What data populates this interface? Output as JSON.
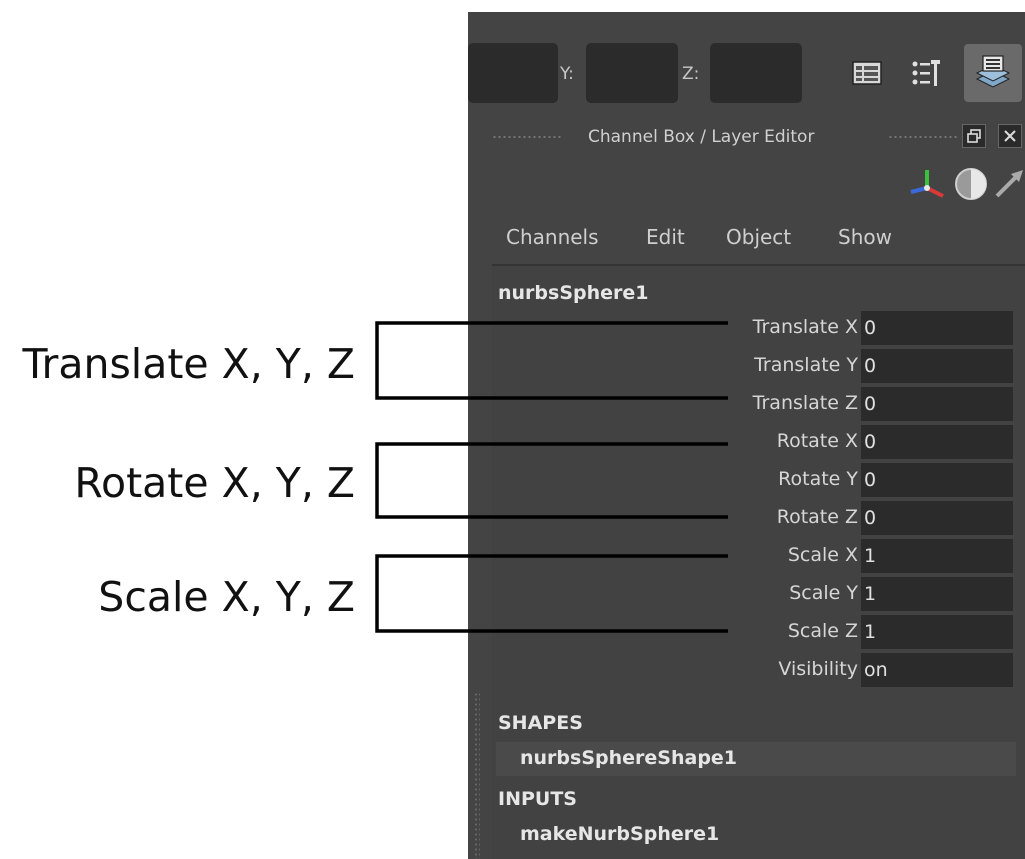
{
  "callouts": {
    "translate": "Translate X, Y, Z",
    "rotate": "Rotate X, Y, Z",
    "scale": "Scale X, Y, Z"
  },
  "toolbar": {
    "y_label": "Y:",
    "z_label": "Z:",
    "icons": [
      "attribute-editor-icon",
      "tool-settings-icon",
      "channel-box-layer-editor-icon"
    ]
  },
  "panel": {
    "title": "Channel Box / Layer Editor",
    "float_button": "🗗",
    "close_button": "✕"
  },
  "menu": [
    "Channels",
    "Edit",
    "Object",
    "Show"
  ],
  "node": "nurbsSphere1",
  "channels": [
    {
      "label": "Translate X",
      "value": "0"
    },
    {
      "label": "Translate Y",
      "value": "0"
    },
    {
      "label": "Translate Z",
      "value": "0"
    },
    {
      "label": "Rotate X",
      "value": "0"
    },
    {
      "label": "Rotate Y",
      "value": "0"
    },
    {
      "label": "Rotate Z",
      "value": "0"
    },
    {
      "label": "Scale X",
      "value": "1"
    },
    {
      "label": "Scale Y",
      "value": "1"
    },
    {
      "label": "Scale Z",
      "value": "1"
    },
    {
      "label": "Visibility",
      "value": "on"
    }
  ],
  "shapes": {
    "heading": "SHAPES",
    "item": "nurbsSphereShape1"
  },
  "inputs": {
    "heading": "INPUTS",
    "item": "makeNurbSphere1"
  }
}
